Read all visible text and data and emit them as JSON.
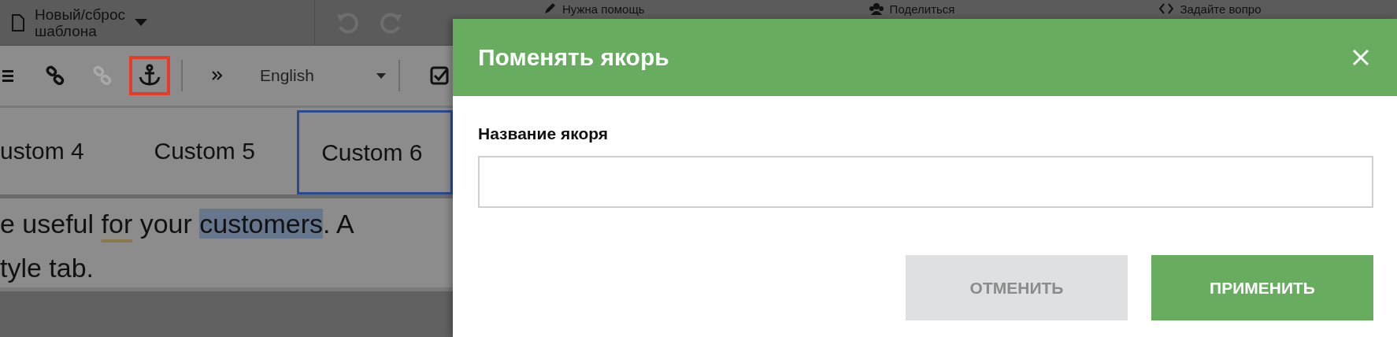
{
  "top_bar": {
    "template_menu": {
      "lines": [
        "Новый/сброс",
        "шаблона"
      ]
    },
    "links": [
      {
        "label": "Нужна помощь",
        "kind": "help"
      },
      {
        "label": "Поделиться",
        "kind": "share"
      },
      {
        "label": "Задайте вопро",
        "kind": "ask"
      }
    ]
  },
  "toolbar": {
    "buttons": [
      {
        "kind": "list",
        "disabled": false,
        "selected": false
      },
      {
        "kind": "link",
        "disabled": false,
        "selected": false
      },
      {
        "kind": "unlink",
        "disabled": true,
        "selected": false
      },
      {
        "kind": "anchor",
        "disabled": false,
        "selected": true
      },
      {
        "kind": "more",
        "disabled": false,
        "selected": false
      }
    ],
    "language": "English"
  },
  "tabs": [
    {
      "label": "ustom 4",
      "selected": false
    },
    {
      "label": "Custom 5",
      "selected": false
    },
    {
      "label": "Custom 6",
      "selected": true
    }
  ],
  "editor": {
    "lines": [
      [
        {
          "text": "e useful ",
          "kind": "plain"
        },
        {
          "text": "for",
          "kind": "flagged"
        },
        {
          "text": " your ",
          "kind": "plain"
        },
        {
          "text": "customers",
          "kind": "selected"
        },
        {
          "text": ". A",
          "kind": "plain"
        }
      ],
      [
        {
          "text": "tyle tab.",
          "kind": "plain"
        }
      ]
    ]
  },
  "dialog": {
    "title": "Поменять якорь",
    "field_label": "Название якоря",
    "buttons": [
      {
        "label": "ОТМЕНИТЬ",
        "kind": "secondary"
      },
      {
        "label": "ПРИМЕНИТЬ",
        "kind": "primary"
      }
    ]
  }
}
